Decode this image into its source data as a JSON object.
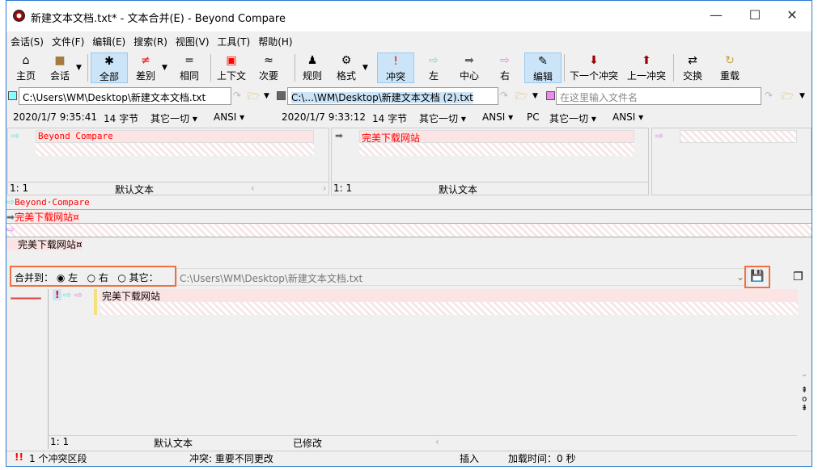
{
  "title": "新建文本文档.txt* - 文本合并(E) - Beyond Compare",
  "menu": [
    "会话(S)",
    "文件(F)",
    "编辑(E)",
    "搜索(R)",
    "视图(V)",
    "工具(T)",
    "帮助(H)"
  ],
  "toolbar": {
    "home": "主页",
    "session": "会话",
    "all": "全部",
    "diff": "差别",
    "same": "相同",
    "context": "上下文",
    "minor": "次要",
    "rules": "规则",
    "format": "格式",
    "conflict": "冲突",
    "left": "左",
    "center": "中心",
    "right": "右",
    "edit": "编辑",
    "next_conflict": "下一个冲突",
    "prev_conflict": "上一冲突",
    "swap": "交换",
    "reload": "重载"
  },
  "files": {
    "left_path": "C:\\Users\\WM\\Desktop\\新建文本文档.txt",
    "center_path": "C:\\...\\WM\\Desktop\\新建文本文档 (2).txt",
    "right_placeholder": "在这里输入文件名"
  },
  "info": {
    "left_date": "2020/1/7 9:35:41",
    "left_size": "14 字节",
    "left_filter": "其它一切",
    "left_enc": "ANSI",
    "center_date": "2020/1/7 9:33:12",
    "center_size": "14 字节",
    "center_filter": "其它一切",
    "center_enc": "ANSI",
    "center_le": "PC",
    "center_filter2": "其它一切",
    "center_enc2": "ANSI"
  },
  "panes": {
    "left_text": "Beyond Compare",
    "center_text": "完美下载网站",
    "left_pos": "1: 1",
    "left_mode": "默认文本",
    "center_pos": "1: 1",
    "center_mode": "默认文本"
  },
  "merged_lines": [
    "Beyond·Compare",
    "完美下载网站¤",
    "",
    "完美下载网站¤"
  ],
  "merge": {
    "label": "合并到：",
    "left": "左",
    "right": "右",
    "other": "其它：",
    "path": "C:\\Users\\WM\\Desktop\\新建文本文档.txt"
  },
  "output": {
    "text": "完美下载网站",
    "pos": "1: 1",
    "mode": "默认文本",
    "state": "已修改"
  },
  "status": {
    "conflicts": "1 个冲突区段",
    "conflict_desc": "冲突: 重要不同更改",
    "insert": "插入",
    "load_time": "加载时间：0 秒"
  }
}
